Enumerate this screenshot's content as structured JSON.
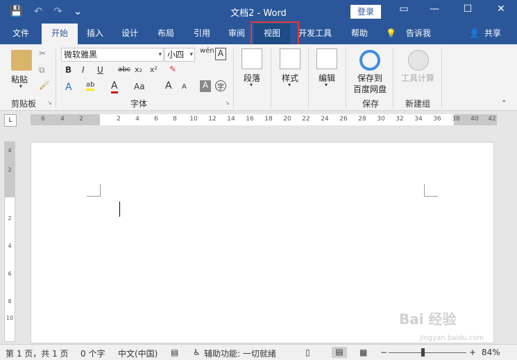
{
  "title_bar": {
    "doc_title": "文档2  -  Word",
    "login": "登录",
    "qat": {
      "save": "💾",
      "undo": "↶",
      "redo": "↷",
      "customize": "⌄"
    }
  },
  "tabs": [
    {
      "label": "文件"
    },
    {
      "label": "开始"
    },
    {
      "label": "插入"
    },
    {
      "label": "设计"
    },
    {
      "label": "布局"
    },
    {
      "label": "引用"
    },
    {
      "label": "审阅"
    },
    {
      "label": "视图"
    },
    {
      "label": "开发工具"
    },
    {
      "label": "帮助"
    }
  ],
  "tell_me": "告诉我",
  "share": "共享",
  "ribbon": {
    "clipboard": {
      "paste": "粘贴",
      "group": "剪贴板"
    },
    "font": {
      "name": "微软雅黑",
      "size": "小四",
      "group": "字体",
      "bold": "B",
      "italic": "I",
      "underline": "U",
      "strike": "abc",
      "sub": "x₂",
      "sup": "x²",
      "grow": "A",
      "shrink": "A",
      "case": "Aa",
      "clear": "A"
    },
    "paragraph": {
      "label": "段落"
    },
    "styles": {
      "label": "样式"
    },
    "editing": {
      "label": "编辑"
    },
    "save": {
      "label1": "保存到",
      "label2": "百度网盘",
      "group": "保存"
    },
    "newgroup": {
      "label": "工具计算",
      "group": "新建组"
    }
  },
  "ruler_numbers": [
    "6",
    "4",
    "2",
    "2",
    "4",
    "6",
    "8",
    "10",
    "12",
    "14",
    "16",
    "18",
    "20",
    "22",
    "24",
    "26",
    "28",
    "30",
    "32",
    "34",
    "36",
    "38",
    "40",
    "42"
  ],
  "vruler_numbers": [
    "4",
    "2",
    "2",
    "4",
    "6",
    "8",
    "10"
  ],
  "status": {
    "page": "第 1 页，共 1 页",
    "words": "0 个字",
    "language": "中文(中国)",
    "accessibility": "辅助功能: 一切就绪",
    "zoom": "84%"
  },
  "watermark": "Bai 经验",
  "watermark_url": "jingyan.baidu.com",
  "colors": {
    "brand": "#2b579a",
    "highlight": "#e53935"
  }
}
